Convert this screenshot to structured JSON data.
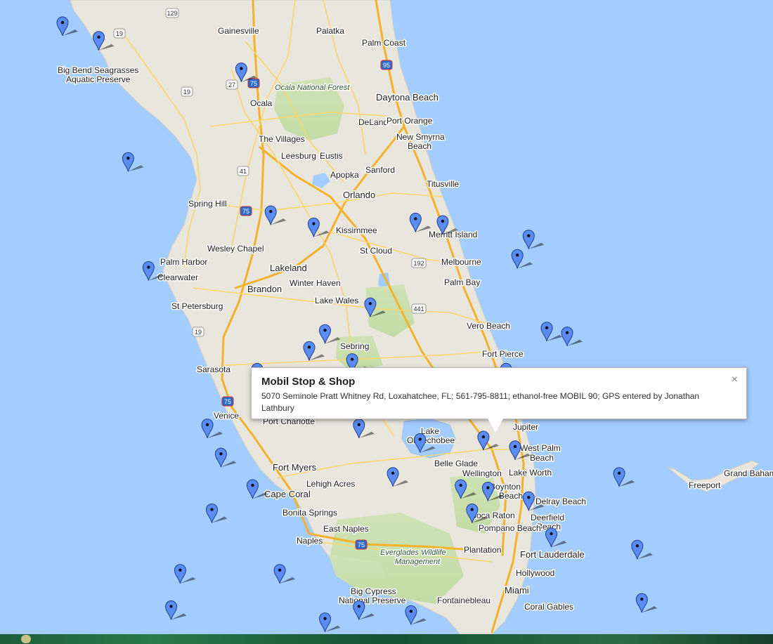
{
  "map": {
    "colors": {
      "water": "#a3ccff",
      "land": "#e8e6dd",
      "park": "#c9dfb0",
      "highway": "#f4b22b",
      "road": "#fad66b",
      "marker": "#5b8cf4"
    },
    "labels": [
      "Gainesville",
      "Palatka",
      "Palm Coast",
      "Big Bend Seagrasses",
      "Aquatic Preserve",
      "Ocala National Forest",
      "Ocala",
      "Daytona Beach",
      "DeLand",
      "Port Orange",
      "New Smyrna",
      "Beach",
      "The Villages",
      "Leesburg",
      "Eustis",
      "Apopka",
      "Sanford",
      "Titusville",
      "Orlando",
      "Spring Hill",
      "Kissimmee",
      "Merritt Island",
      "Wesley Chapel",
      "St Cloud",
      "Melbourne",
      "Clearwater",
      "Palm Harbor",
      "Lakeland",
      "Winter Haven",
      "Brandon",
      "Palm Bay",
      "St Petersburg",
      "Lake Wales",
      "Vero Beach",
      "Sebring",
      "Fort Pierce",
      "Sarasota",
      "Venice",
      "Port Charlotte",
      "Jupiter",
      "Lake",
      "Okeechobee",
      "Belle Glade",
      "West Palm",
      "Beach",
      "Wellington",
      "Lake Worth",
      "Fort Myers",
      "Lehigh Acres",
      "Cape Coral",
      "Boynton",
      "Beach",
      "Delray Beach",
      "Grand Bahama",
      "Freeport",
      "Bonita Springs",
      "Boca Raton",
      "Deerfield",
      "Beach",
      "Pompano Beach",
      "East Naples",
      "Naples",
      "Fort Lauderdale",
      "Plantation",
      "Everglades Wildlife",
      "Management",
      "Hollywood",
      "Miami",
      "Big Cypress",
      "National Preserve",
      "Fontainebleau",
      "Coral Gables"
    ],
    "shields": [
      "129",
      "19",
      "19",
      "27",
      "75",
      "95",
      "41",
      "75",
      "192",
      "441",
      "19",
      "75",
      "75"
    ]
  },
  "info_window": {
    "title": "Mobil Stop & Shop",
    "description": "5070 Seminole Pratt Whitney Rd, Loxahatchee, FL; 561-795-8811; ethanol-free MOBIL 90; GPS entered by Jonathan Lathbury",
    "close_label": "×"
  },
  "markers": [
    {
      "lon": -83.26,
      "lat": 30.46
    },
    {
      "lon": -83.1,
      "lat": 30.4
    },
    {
      "lon": -82.97,
      "lat": 29.9
    },
    {
      "lon": -82.88,
      "lat": 29.45
    },
    {
      "lon": -82.47,
      "lat": 30.27
    },
    {
      "lon": -82.34,
      "lat": 29.68
    },
    {
      "lon": -82.15,
      "lat": 29.63
    },
    {
      "lon": -81.7,
      "lat": 29.65
    },
    {
      "lon": -81.58,
      "lat": 29.64
    },
    {
      "lon": -81.2,
      "lat": 29.58
    },
    {
      "lon": -81.25,
      "lat": 29.5
    },
    {
      "lon": -81.9,
      "lat": 29.3
    },
    {
      "lon": -81.12,
      "lat": 29.2
    },
    {
      "lon": -81.03,
      "lat": 29.18
    },
    {
      "lon": -81.0,
      "lat": 29.0
    },
    {
      "lon": -82.1,
      "lat": 29.19
    },
    {
      "lon": -82.17,
      "lat": 29.12
    },
    {
      "lon": -81.98,
      "lat": 29.07
    },
    {
      "lon": -82.4,
      "lat": 29.03
    },
    {
      "lon": -81.3,
      "lat": 29.03
    },
    {
      "lon": -81.87,
      "lat": 28.98
    },
    {
      "lon": -82.62,
      "lat": 28.8
    },
    {
      "lon": -82.56,
      "lat": 28.68
    },
    {
      "lon": -82.42,
      "lat": 28.55
    },
    {
      "lon": -81.68,
      "lat": 28.74
    },
    {
      "lon": -81.95,
      "lat": 28.8
    },
    {
      "lon": -81.4,
      "lat": 28.75
    },
    {
      "lon": -81.26,
      "lat": 28.71
    },
    {
      "lon": -81.8,
      "lat": 28.6
    },
    {
      "lon": -81.5,
      "lat": 28.55
    },
    {
      "lon": -81.38,
      "lat": 28.54
    },
    {
      "lon": -81.45,
      "lat": 28.45
    },
    {
      "lon": -81.2,
      "lat": 28.5
    },
    {
      "lon": -81.1,
      "lat": 28.35
    },
    {
      "lon": -80.8,
      "lat": 28.6
    },
    {
      "lon": -80.72,
      "lat": 28.3
    },
    {
      "lon": -80.7,
      "lat": 28.08
    },
    {
      "lon": -80.62,
      "lat": 27.95
    },
    {
      "lon": -82.6,
      "lat": 28.45
    },
    {
      "lon": -82.74,
      "lat": 28.2
    },
    {
      "lon": -82.78,
      "lat": 28.05
    },
    {
      "lon": -82.72,
      "lat": 27.95
    },
    {
      "lon": -82.68,
      "lat": 27.85
    },
    {
      "lon": -82.62,
      "lat": 27.76
    },
    {
      "lon": -82.5,
      "lat": 27.95
    },
    {
      "lon": -82.4,
      "lat": 27.9
    },
    {
      "lon": -82.3,
      "lat": 28.2
    },
    {
      "lon": -82.1,
      "lat": 28.0
    },
    {
      "lon": -81.95,
      "lat": 28.05
    },
    {
      "lon": -81.8,
      "lat": 27.98
    },
    {
      "lon": -81.72,
      "lat": 28.03
    },
    {
      "lon": -81.6,
      "lat": 27.9
    },
    {
      "lon": -81.36,
      "lat": 27.92
    },
    {
      "lon": -81.2,
      "lat": 27.72
    },
    {
      "lon": -80.9,
      "lat": 27.6
    },
    {
      "lon": -81.6,
      "lat": 27.55
    },
    {
      "lon": -81.44,
      "lat": 27.48
    },
    {
      "lon": -82.55,
      "lat": 27.5
    },
    {
      "lon": -82.5,
      "lat": 27.34
    },
    {
      "lon": -82.45,
      "lat": 27.2
    },
    {
      "lon": -82.28,
      "lat": 27.05
    },
    {
      "lon": -82.15,
      "lat": 26.98
    },
    {
      "lon": -81.85,
      "lat": 26.65
    },
    {
      "lon": -81.95,
      "lat": 26.58
    },
    {
      "lon": -81.75,
      "lat": 26.45
    },
    {
      "lon": -81.8,
      "lat": 26.25
    },
    {
      "lon": -81.78,
      "lat": 26.14
    },
    {
      "lon": -81.7,
      "lat": 26.1
    },
    {
      "lon": -81.4,
      "lat": 25.85
    },
    {
      "lon": -81.62,
      "lat": 25.95
    },
    {
      "lon": -81.0,
      "lat": 26.7
    },
    {
      "lon": -80.66,
      "lat": 26.69
    },
    {
      "lon": -80.4,
      "lat": 27.18
    },
    {
      "lon": -80.33,
      "lat": 27.45
    },
    {
      "lon": -80.32,
      "lat": 27.6
    },
    {
      "lon": -80.4,
      "lat": 27.64
    },
    {
      "lon": -80.35,
      "lat": 27.45
    },
    {
      "lon": -80.18,
      "lat": 26.95
    },
    {
      "lon": -80.1,
      "lat": 26.72
    },
    {
      "lon": -80.06,
      "lat": 26.6
    },
    {
      "lon": -80.07,
      "lat": 26.5
    },
    {
      "lon": -80.08,
      "lat": 26.35
    },
    {
      "lon": -80.12,
      "lat": 26.3
    },
    {
      "lon": -80.14,
      "lat": 26.15
    },
    {
      "lon": -80.14,
      "lat": 26.12
    },
    {
      "lon": -80.23,
      "lat": 26.12
    },
    {
      "lon": -80.15,
      "lat": 26.0
    },
    {
      "lon": -80.2,
      "lat": 25.9
    },
    {
      "lon": -80.19,
      "lat": 25.77
    },
    {
      "lon": -80.25,
      "lat": 25.72
    },
    {
      "lon": -80.35,
      "lat": 25.6
    },
    {
      "lon": -80.45,
      "lat": 25.48
    },
    {
      "lon": -80.38,
      "lat": 25.47
    },
    {
      "lon": -80.6,
      "lat": 26.7
    },
    {
      "lon": -80.4,
      "lat": 26.65
    },
    {
      "lon": -80.25,
      "lat": 26.7
    }
  ]
}
